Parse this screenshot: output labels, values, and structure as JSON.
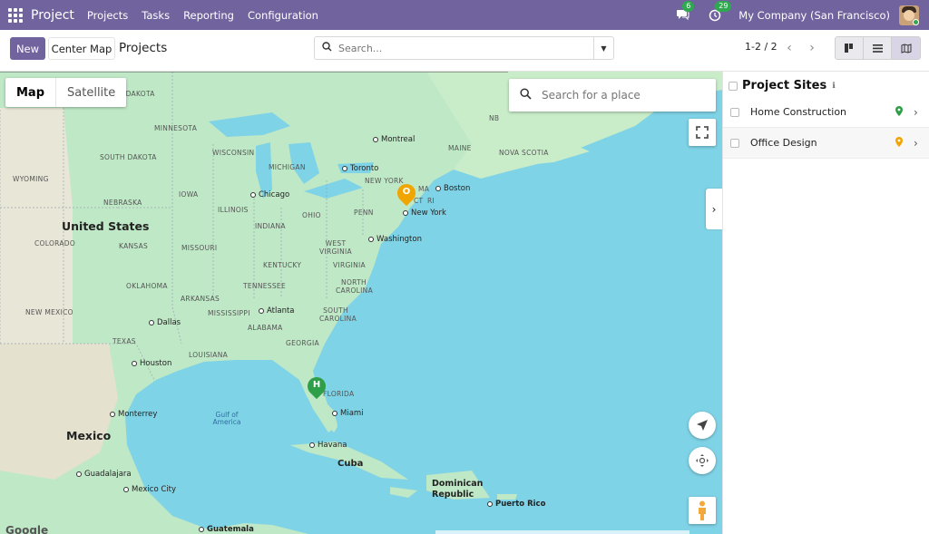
{
  "topnav": {
    "brand": "Project",
    "menu": [
      "Projects",
      "Tasks",
      "Reporting",
      "Configuration"
    ],
    "messages_count": "6",
    "activities_count": "29",
    "company": "My Company (San Francisco)"
  },
  "control": {
    "new_label": "New",
    "center_map_label": "Center Map",
    "breadcrumb": "Projects",
    "search_placeholder": "Search...",
    "pager": "1-2 / 2"
  },
  "map": {
    "map_tab": "Map",
    "satellite_tab": "Satellite",
    "search_placeholder": "Search for a place",
    "google": "Google",
    "countries": [
      "United States",
      "Mexico",
      "Cuba",
      "Dominican Republic"
    ],
    "cities": [
      "Montreal",
      "Toronto",
      "Chicago",
      "Boston",
      "New York",
      "Washington",
      "Atlanta",
      "Dallas",
      "Houston",
      "Miami",
      "Monterrey",
      "Havana",
      "Guadalajara",
      "Mexico City",
      "Puerto Rico",
      "Guatemala"
    ],
    "states": [
      "NORTH DAKOTA",
      "MINNESOTA",
      "SOUTH DAKOTA",
      "WISCONSIN",
      "MICHIGAN",
      "WYOMING",
      "NEBRASKA",
      "IOWA",
      "ILLINOIS",
      "INDIANA",
      "OHIO",
      "PENN",
      "NEW YORK",
      "MAINE",
      "NOVA SCOTIA",
      "NB",
      "MA",
      "CT",
      "RI",
      "COLORADO",
      "KANSAS",
      "MISSOURI",
      "KENTUCKY",
      "WEST VIRGINIA",
      "VIRGINIA",
      "OKLAHOMA",
      "ARKANSAS",
      "TENNESSEE",
      "NORTH CAROLINA",
      "SOUTH CAROLINA",
      "NEW MEXICO",
      "MISSISSIPPI",
      "ALABAMA",
      "TEXAS",
      "LOUISIANA",
      "GEORGIA",
      "FLORIDA"
    ],
    "water": "Gulf of America",
    "markers": [
      {
        "letter": "O",
        "color": "#f0a500"
      },
      {
        "letter": "H",
        "color": "#2e9e48"
      }
    ]
  },
  "sites": {
    "title": "Project Sites",
    "items": [
      {
        "name": "Home Construction",
        "pin_color": "#2e9e48"
      },
      {
        "name": "Office Design",
        "pin_color": "#f0a500"
      }
    ]
  },
  "colors": {
    "brand": "#71639e",
    "water": "#7fd3e6",
    "land": "#bfe8c6"
  }
}
